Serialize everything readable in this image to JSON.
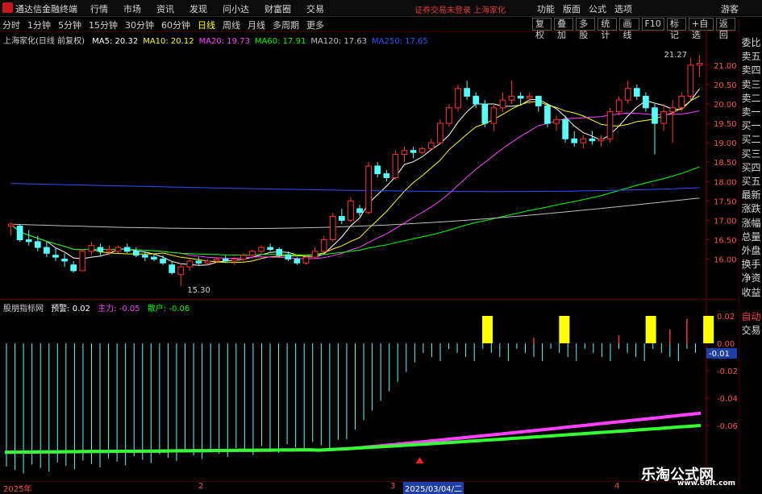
{
  "app": {
    "title": "通达信金融终端"
  },
  "menu": [
    "行情",
    "市场",
    "资讯",
    "发现",
    "问小达",
    "财富圈",
    "交易"
  ],
  "notice": "证券交易未登录 上海家化",
  "top_right": [
    "功能",
    "版面",
    "公式",
    "选项"
  ],
  "user": "游客",
  "periods": [
    "分时",
    "1分钟",
    "5分钟",
    "15分钟",
    "30分钟",
    "60分钟",
    "日线",
    "周线",
    "月线",
    "多周期",
    "更多"
  ],
  "active_period": "日线",
  "tools": [
    "复权",
    "叠加",
    "多股",
    "统计",
    "画线",
    "F10",
    "标记",
    "+自选",
    "返回"
  ],
  "stock": {
    "name": "上海家化(日线 前复权)"
  },
  "ma_legend": [
    {
      "label": "MA5: 20.32",
      "color": "#ffffff"
    },
    {
      "label": "MA10: 20.12",
      "color": "#ffff00"
    },
    {
      "label": "MA20: 19.73",
      "color": "#ff40ff"
    },
    {
      "label": "MA60: 17.91",
      "color": "#00ff00"
    },
    {
      "label": "MA120: 17.63",
      "color": "#c0c0c0"
    },
    {
      "label": "MA250: 17.65",
      "color": "#3050ff"
    }
  ],
  "price_axis": [
    "21.00",
    "20.50",
    "20.00",
    "19.50",
    "19.00",
    "18.50",
    "18.00",
    "17.50",
    "17.00",
    "16.50",
    "16.00"
  ],
  "annotations": {
    "high": "21.27",
    "low": "15.30"
  },
  "indicator": {
    "name": "股朋指标网",
    "warn": "预警: 0.02",
    "main": "主力: -0.05",
    "retail": "散户: -0.06",
    "axis": [
      "0.02",
      "0.00",
      "-0.02",
      "-0.04",
      "-0.06"
    ],
    "current": "-0.01"
  },
  "right_panel": {
    "items": [
      "委比",
      "卖五",
      "卖四",
      "卖三",
      "卖二",
      "卖一",
      "买一",
      "买二",
      "买三",
      "买四",
      "买五",
      "最新",
      "涨跌",
      "涨幅",
      "总量",
      "外盘",
      "换手",
      "净资",
      "收益"
    ],
    "auto": "自动",
    "trade": "交易"
  },
  "x_axis": {
    "labels": [
      "2025年",
      "2",
      "3",
      "4"
    ],
    "cursor": "2025/03/04/二"
  },
  "watermark": {
    "title": "乐淘公式网",
    "url": "www.60lt.com"
  },
  "chart_data": {
    "type": "candlestick",
    "ylim": [
      15.2,
      21.6
    ],
    "candles": [
      [
        16.85,
        16.95,
        16.6,
        16.9
      ],
      [
        16.85,
        16.9,
        16.45,
        16.5
      ],
      [
        16.5,
        16.75,
        16.35,
        16.45
      ],
      [
        16.45,
        16.6,
        16.2,
        16.3
      ],
      [
        16.3,
        16.45,
        16.05,
        16.15
      ],
      [
        16.1,
        16.3,
        15.95,
        16.05
      ],
      [
        16.0,
        16.15,
        15.8,
        15.95
      ],
      [
        15.85,
        15.95,
        15.65,
        15.7
      ],
      [
        15.7,
        16.25,
        15.7,
        16.2
      ],
      [
        16.2,
        16.45,
        16.1,
        16.35
      ],
      [
        16.3,
        16.4,
        16.1,
        16.2
      ],
      [
        16.2,
        16.35,
        16.1,
        16.25
      ],
      [
        16.2,
        16.35,
        16.15,
        16.3
      ],
      [
        16.3,
        16.4,
        16.15,
        16.2
      ],
      [
        16.2,
        16.3,
        16.05,
        16.1
      ],
      [
        16.1,
        16.2,
        15.95,
        16.05
      ],
      [
        16.05,
        16.15,
        15.95,
        16.0
      ],
      [
        16.0,
        16.1,
        15.85,
        15.9
      ],
      [
        15.85,
        15.95,
        15.6,
        15.65
      ],
      [
        15.6,
        15.9,
        15.3,
        15.8
      ],
      [
        15.8,
        16.0,
        15.7,
        15.95
      ],
      [
        15.95,
        16.05,
        15.85,
        15.9
      ],
      [
        15.9,
        16.0,
        15.85,
        15.95
      ],
      [
        15.95,
        16.05,
        15.9,
        16.0
      ],
      [
        16.0,
        16.1,
        15.9,
        15.95
      ],
      [
        15.95,
        16.05,
        15.85,
        16.0
      ],
      [
        16.0,
        16.15,
        15.9,
        16.1
      ],
      [
        16.1,
        16.25,
        16.0,
        16.2
      ],
      [
        16.2,
        16.35,
        16.1,
        16.3
      ],
      [
        16.3,
        16.4,
        16.2,
        16.25
      ],
      [
        16.25,
        16.3,
        16.05,
        16.1
      ],
      [
        16.1,
        16.2,
        15.95,
        16.0
      ],
      [
        16.0,
        16.05,
        15.85,
        15.9
      ],
      [
        15.9,
        16.1,
        15.85,
        16.05
      ],
      [
        16.05,
        16.3,
        16.0,
        16.2
      ],
      [
        16.2,
        16.6,
        16.15,
        16.5
      ],
      [
        16.5,
        17.2,
        16.45,
        17.1
      ],
      [
        17.1,
        17.3,
        16.9,
        17.0
      ],
      [
        17.0,
        17.6,
        16.95,
        17.5
      ],
      [
        17.3,
        17.4,
        17.1,
        17.2
      ],
      [
        17.2,
        18.5,
        17.15,
        18.4
      ],
      [
        18.4,
        18.5,
        18.1,
        18.2
      ],
      [
        18.2,
        18.3,
        18.0,
        18.1
      ],
      [
        18.1,
        18.8,
        18.05,
        18.7
      ],
      [
        18.7,
        18.9,
        18.5,
        18.8
      ],
      [
        18.8,
        18.9,
        18.6,
        18.75
      ],
      [
        18.75,
        18.9,
        18.7,
        18.85
      ],
      [
        18.85,
        19.1,
        18.8,
        19.0
      ],
      [
        19.0,
        19.6,
        18.95,
        19.5
      ],
      [
        19.5,
        20.0,
        19.4,
        19.9
      ],
      [
        19.9,
        20.5,
        19.8,
        20.4
      ],
      [
        20.4,
        20.6,
        20.1,
        20.2
      ],
      [
        20.2,
        20.3,
        19.9,
        20.0
      ],
      [
        20.0,
        20.1,
        19.4,
        19.5
      ],
      [
        19.5,
        20.0,
        19.3,
        19.9
      ],
      [
        19.9,
        20.3,
        19.8,
        20.1
      ],
      [
        20.1,
        20.6,
        20.0,
        20.2
      ],
      [
        20.2,
        20.3,
        20.0,
        20.15
      ],
      [
        20.15,
        20.3,
        20.0,
        20.2
      ],
      [
        20.2,
        20.2,
        19.8,
        19.95
      ],
      [
        19.95,
        20.0,
        19.4,
        19.5
      ],
      [
        19.5,
        19.7,
        19.3,
        19.6
      ],
      [
        19.6,
        19.7,
        19.0,
        19.1
      ],
      [
        19.1,
        19.3,
        18.9,
        19.0
      ],
      [
        19.0,
        19.2,
        18.85,
        19.1
      ],
      [
        19.1,
        19.3,
        18.95,
        19.05
      ],
      [
        19.05,
        19.2,
        18.9,
        19.1
      ],
      [
        19.1,
        19.9,
        19.0,
        19.8
      ],
      [
        19.8,
        20.2,
        19.7,
        20.1
      ],
      [
        20.1,
        20.6,
        20.0,
        20.4
      ],
      [
        20.4,
        20.5,
        20.1,
        20.2
      ],
      [
        20.2,
        20.3,
        19.8,
        19.9
      ],
      [
        19.9,
        20.0,
        18.7,
        19.5
      ],
      [
        19.5,
        20.0,
        19.3,
        19.8
      ],
      [
        19.8,
        20.1,
        19.0,
        19.9
      ],
      [
        19.9,
        20.3,
        19.8,
        20.2
      ],
      [
        20.2,
        21.2,
        20.1,
        21.0
      ],
      [
        21.0,
        21.27,
        20.7,
        21.05
      ]
    ]
  }
}
